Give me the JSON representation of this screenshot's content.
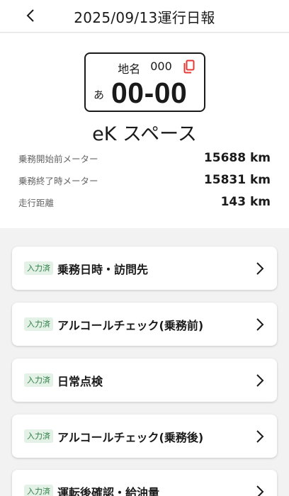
{
  "header": {
    "title": "2025/09/13運行日報",
    "back_icon": "chevron-left-icon"
  },
  "vehicle": {
    "plate": {
      "region": "地名",
      "class_number": "000",
      "kana": "あ",
      "number": "00-00",
      "copy_icon": "copy-icon",
      "copy_icon_color": "#e53935"
    },
    "name": "eK スペース",
    "meters": [
      {
        "label": "乗務開始前メーター",
        "value": "15688 km"
      },
      {
        "label": "乗務終了時メーター",
        "value": "15831 km"
      },
      {
        "label": "走行距離",
        "value": "143 km"
      }
    ]
  },
  "sections": [
    {
      "status": "入力済",
      "label": "乗務日時・訪問先"
    },
    {
      "status": "入力済",
      "label": "アルコールチェック(乗務前)"
    },
    {
      "status": "入力済",
      "label": "日常点検"
    },
    {
      "status": "入力済",
      "label": "アルコールチェック(乗務後)"
    },
    {
      "status": "入力済",
      "label": "運転後確認・給油量"
    }
  ],
  "colors": {
    "badge_bg": "#e3f1e6",
    "badge_text": "#2e7d46",
    "page_bg": "#f2f2f2"
  }
}
